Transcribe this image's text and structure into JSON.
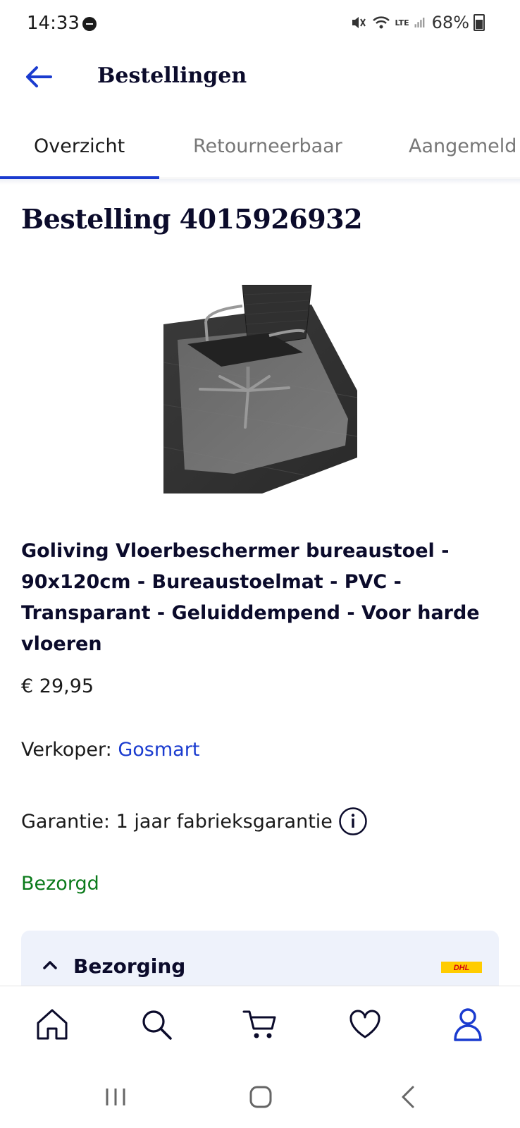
{
  "status_bar": {
    "time": "14:33",
    "battery": "68%",
    "network": "LTE"
  },
  "header": {
    "title": "Bestellingen"
  },
  "tabs": [
    {
      "label": "Overzicht",
      "active": true
    },
    {
      "label": "Retourneerbaar",
      "active": false
    },
    {
      "label": "Aangemeld",
      "active": false
    }
  ],
  "order": {
    "title": "Bestelling 4015926932",
    "product": {
      "title": "Goliving Vloerbeschermer bureaustoel - 90x120cm - Bureaustoelmat - PVC - Transparant - Geluiddempend - Voor harde vloeren",
      "price": "€ 29,95",
      "seller_label": "Verkoper:",
      "seller_name": "Gosmart",
      "warranty": "Garantie: 1 jaar fabrieksgarantie",
      "status": "Bezorgd"
    },
    "delivery": {
      "label": "Bezorging",
      "carrier": "DHL"
    }
  },
  "bottom_nav": {
    "items": [
      "home-icon",
      "search-icon",
      "cart-icon",
      "heart-icon",
      "account-icon"
    ],
    "active": "account-icon"
  },
  "colors": {
    "brand_blue": "#1a3bcf",
    "status_green": "#0a7a1a",
    "heading_navy": "#0b0b2b",
    "card_bg": "#eef2fb",
    "dhl_yellow": "#ffcc00",
    "dhl_red": "#d40511"
  }
}
